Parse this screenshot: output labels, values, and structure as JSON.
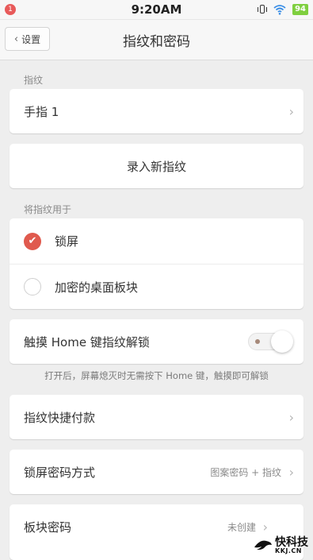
{
  "status_bar": {
    "notification_count": "1",
    "time": "9:20AM",
    "battery": "94",
    "icons": [
      "vibrate-icon",
      "wifi-icon",
      "battery-icon"
    ]
  },
  "nav": {
    "back_label": "设置",
    "title": "指纹和密码"
  },
  "fingerprints": {
    "section_label": "指纹",
    "items": [
      {
        "label": "手指 1"
      }
    ],
    "add_label": "录入新指纹"
  },
  "usage": {
    "section_label": "将指纹用于",
    "options": [
      {
        "label": "锁屏",
        "checked": true
      },
      {
        "label": "加密的桌面板块",
        "checked": false
      }
    ]
  },
  "home_unlock": {
    "label": "触摸 Home 键指纹解锁",
    "enabled": true,
    "hint": "打开后，屏幕熄灭时无需按下 Home 键，触摸即可解锁"
  },
  "payment": {
    "label": "指纹快捷付款"
  },
  "lock_method": {
    "label": "锁屏密码方式",
    "value": "图案密码 + 指纹"
  },
  "block_password": {
    "label": "板块密码",
    "value": "未创建"
  },
  "watermark": {
    "cn": "快科技",
    "en": "KKJ.CN"
  },
  "colors": {
    "accent": "#e05a4e",
    "battery": "#7fcf3f",
    "background": "#eeeeee"
  }
}
